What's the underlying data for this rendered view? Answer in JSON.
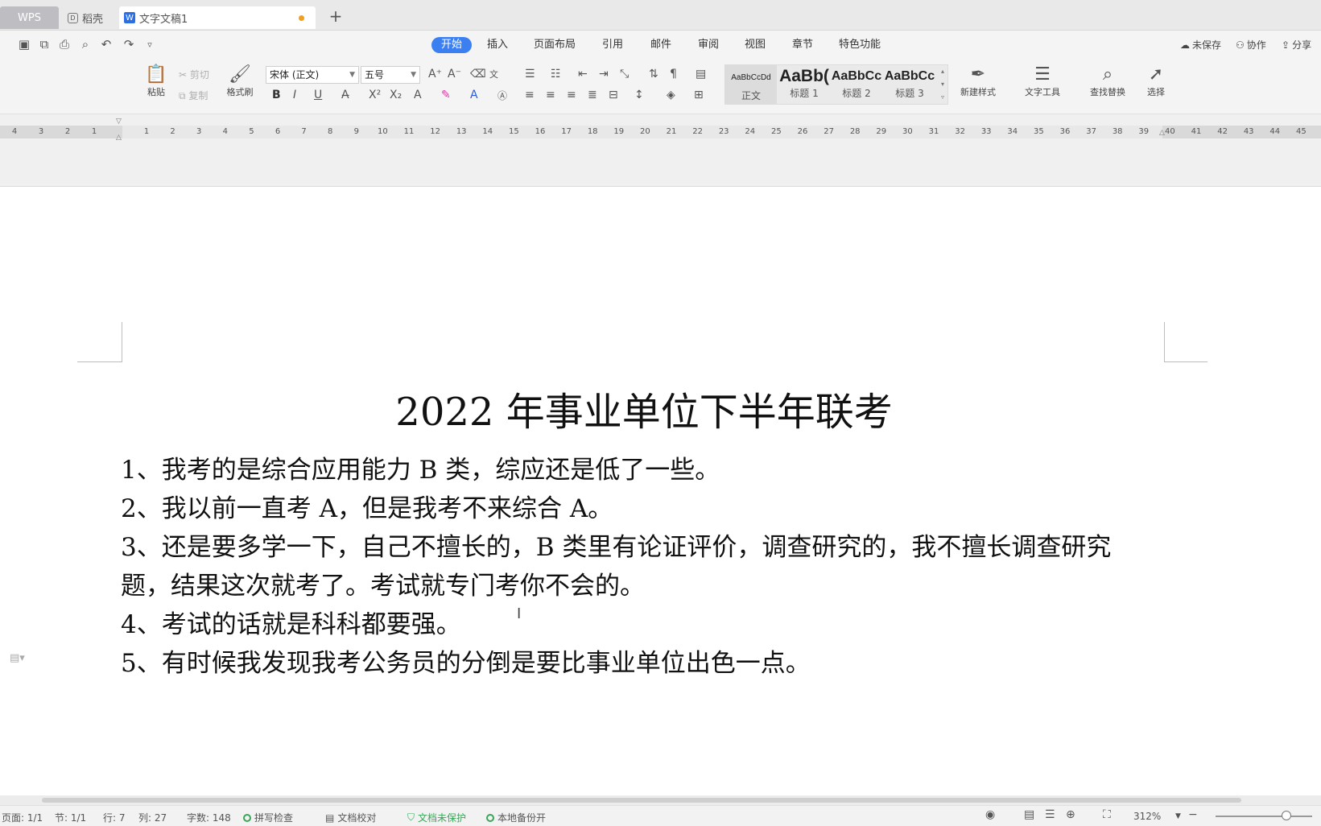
{
  "tabs": {
    "wps": "WPS",
    "daoke": "稻壳",
    "doc": "文字文稿1",
    "plus": "+"
  },
  "menu": {
    "items": [
      "开始",
      "插入",
      "页面布局",
      "引用",
      "邮件",
      "审阅",
      "视图",
      "章节",
      "特色功能"
    ],
    "unsaved": "未保存",
    "collab": "协作",
    "share": "分享"
  },
  "ribbon": {
    "paste": "粘贴",
    "cut": "剪切",
    "copy": "复制",
    "format_painter": "格式刷",
    "font_name": "宋体 (正文)",
    "font_size": "五号",
    "styles": [
      {
        "preview": "AaBbCcDd",
        "label": "正文"
      },
      {
        "preview": "AaBb(",
        "label": "标题 1"
      },
      {
        "preview": "AaBbCc",
        "label": "标题 2"
      },
      {
        "preview": "AaBbCc",
        "label": "标题 3"
      }
    ],
    "new_style": "新建样式",
    "text_tools": "文字工具",
    "find_replace": "查找替换",
    "select": "选择"
  },
  "ruler": {
    "left": [
      "4",
      "3",
      "2",
      "1"
    ],
    "right": [
      "1",
      "2",
      "3",
      "4",
      "5",
      "6",
      "7",
      "8",
      "9",
      "10",
      "11",
      "12",
      "13",
      "14",
      "15",
      "16",
      "17",
      "18",
      "19",
      "20",
      "21",
      "22",
      "23",
      "24",
      "25",
      "26",
      "27",
      "28",
      "29",
      "30",
      "31",
      "32",
      "33",
      "34",
      "35",
      "36",
      "37",
      "38",
      "39",
      "40",
      "41",
      "42",
      "43",
      "44",
      "45"
    ]
  },
  "document": {
    "title": "2022 年事业单位下半年联考",
    "lines": [
      "1、我考的是综合应用能力 B 类，综应还是低了一些。",
      "2、我以前一直考 A，但是我考不来综合 A。",
      "3、还是要多学一下，自己不擅长的，B 类里有论证评价，调查研究的，我不擅长调查研究",
      "题，结果这次就考了。考试就专门考你不会的。",
      "4、考试的话就是科科都要强。",
      "5、有时候我发现我考公务员的分倒是要比事业单位出色一点。"
    ]
  },
  "status": {
    "page": "页面: 1/1",
    "section": "节: 1/1",
    "row": "行: 7",
    "col": "列: 27",
    "words": "字数: 148",
    "spell": "拼写检查",
    "proof": "文档校对",
    "protect": "文档未保护",
    "backup": "本地备份开",
    "zoom": "312%"
  }
}
